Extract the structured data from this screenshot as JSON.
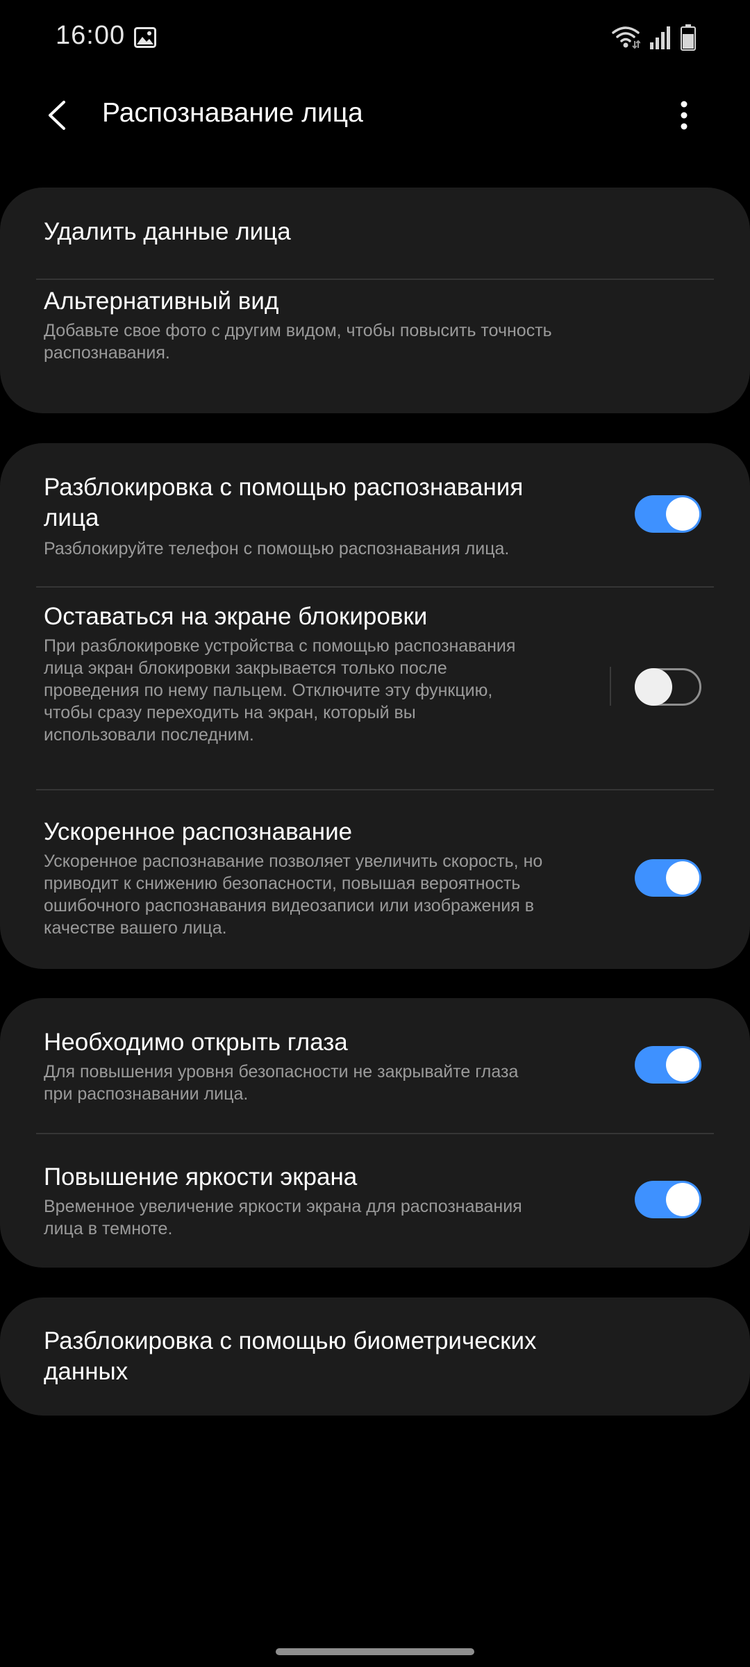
{
  "status_bar": {
    "time": "16:00",
    "icons": [
      "gallery-icon",
      "wifi-icon",
      "signal-icon",
      "battery-icon"
    ]
  },
  "app_bar": {
    "title": "Распознавание лица",
    "back_icon": "back-arrow-icon",
    "more_icon": "more-vertical-icon"
  },
  "colors": {
    "background": "#000000",
    "card": "#1c1c1c",
    "accent": "#3e91ff",
    "summary_text": "#9a9a9a"
  },
  "cards": [
    {
      "items": [
        {
          "title": "Удалить данные лица"
        },
        {
          "title": "Альтернативный вид",
          "summary_lines": [
            "Добавьте свое фото с другим видом, чтобы повысить точность",
            "распознавания."
          ]
        }
      ]
    },
    {
      "items": [
        {
          "title_lines": [
            "Разблокировка с помощью распознавания",
            "лица"
          ],
          "summary_lines": [
            "Разблокируйте телефон с помощью распознавания лица."
          ],
          "switch": true
        },
        {
          "title": "Оставаться на экране блокировки",
          "summary_lines": [
            "При разблокировке устройства с помощью распознавания",
            "лица экран блокировки закрывается только после",
            "проведения по нему пальцем. Отключите эту функцию,",
            "чтобы сразу переходить на экран, который вы",
            "использовали последним."
          ],
          "switch": false
        },
        {
          "title": "Ускоренное распознавание",
          "summary_lines": [
            "Ускоренное распознавание позволяет увеличить скорость, но",
            "приводит к снижению безопасности, повышая вероятность",
            "ошибочного распознавания видеозаписи или изображения в",
            "качестве вашего лица."
          ],
          "switch": true
        }
      ]
    },
    {
      "items": [
        {
          "title": "Необходимо открыть глаза",
          "summary_lines": [
            "Для повышения уровня безопасности не закрывайте глаза",
            "при распознавании лица."
          ],
          "switch": true
        },
        {
          "title": "Повышение яркости экрана",
          "summary_lines": [
            "Временное увеличение яркости экрана для распознавания",
            "лица в темноте."
          ],
          "switch": true
        }
      ]
    },
    {
      "items": [
        {
          "title_lines": [
            "Разблокировка с помощью биометрических",
            "данных"
          ]
        }
      ]
    }
  ]
}
